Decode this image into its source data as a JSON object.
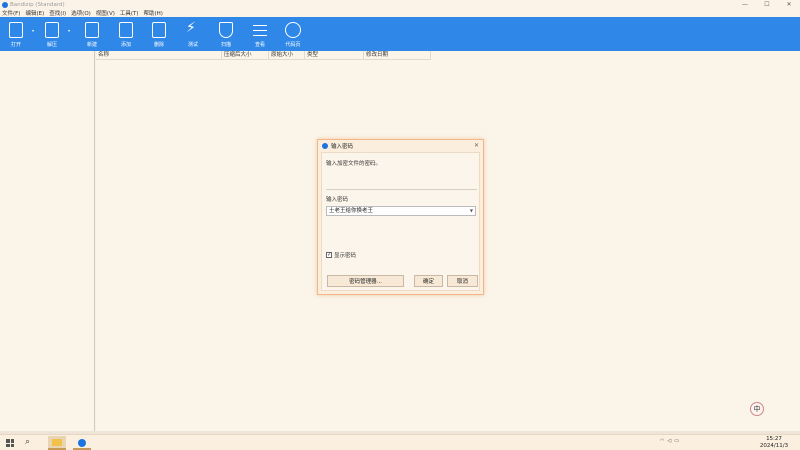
{
  "window": {
    "title": "Bandizip (Standard)",
    "controls": [
      "—",
      "☐",
      "✕"
    ]
  },
  "menu": [
    "文件(F)",
    "编辑(E)",
    "查找(I)",
    "选项(O)",
    "视图(V)",
    "工具(T)",
    "帮助(H)"
  ],
  "toolbar": {
    "open": "打开",
    "extract": "解压",
    "new": "新建",
    "add": "添加",
    "delete": "删除",
    "test": "测试",
    "scan": "扫描",
    "view": "查看",
    "codepage": "代码页"
  },
  "filelist": {
    "columns": [
      "名称",
      "压缩后大小",
      "原始大小",
      "类型",
      "修改日期"
    ]
  },
  "dialog": {
    "title": "输入密码",
    "prompt": "输入加密文件的密码。",
    "password_label": "输入密码",
    "password_value": "土老王给你换老王",
    "show_password_label": "显示密码",
    "show_password_checked": true,
    "manager_button": "密码管理器...",
    "ok_button": "确定",
    "cancel_button": "取消"
  },
  "taskbar": {
    "clock_time": "15:27",
    "clock_date": "2024/11/3",
    "ime": "中"
  }
}
